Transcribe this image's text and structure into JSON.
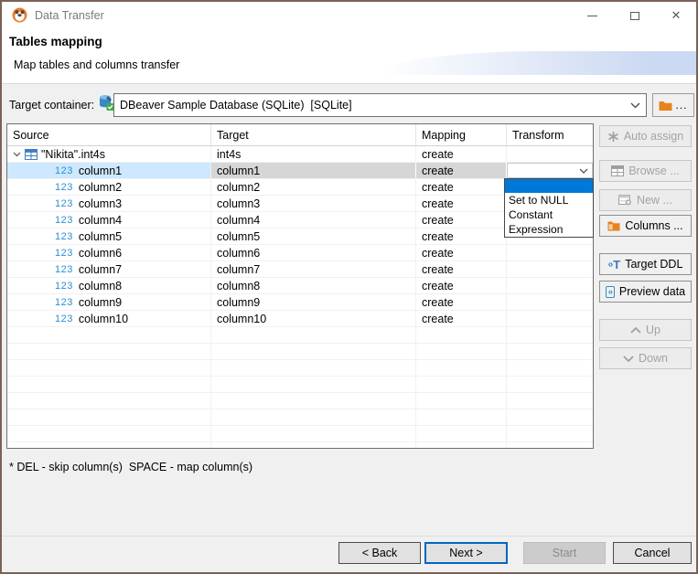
{
  "window": {
    "title": "Data Transfer"
  },
  "header": {
    "title": "Tables mapping",
    "subtitle": "Map tables and columns transfer"
  },
  "target_container": {
    "label": "Target container:",
    "value": "DBeaver Sample Database (SQLite)  [SQLite]",
    "browse_label": "..."
  },
  "table": {
    "columns": [
      "Source",
      "Target",
      "Mapping",
      "Transform"
    ],
    "tree_row": {
      "source": "\"Nikita\".int4s",
      "target": "int4s",
      "mapping": "create"
    },
    "type_badge": "123",
    "rows": [
      {
        "source": "column1",
        "target": "column1",
        "mapping": "create",
        "selected": true
      },
      {
        "source": "column2",
        "target": "column2",
        "mapping": "create",
        "selected": false
      },
      {
        "source": "column3",
        "target": "column3",
        "mapping": "create",
        "selected": false
      },
      {
        "source": "column4",
        "target": "column4",
        "mapping": "create",
        "selected": false
      },
      {
        "source": "column5",
        "target": "column5",
        "mapping": "create",
        "selected": false
      },
      {
        "source": "column6",
        "target": "column6",
        "mapping": "create",
        "selected": false
      },
      {
        "source": "column7",
        "target": "column7",
        "mapping": "create",
        "selected": false
      },
      {
        "source": "column8",
        "target": "column8",
        "mapping": "create",
        "selected": false
      },
      {
        "source": "column9",
        "target": "column9",
        "mapping": "create",
        "selected": false
      },
      {
        "source": "column10",
        "target": "column10",
        "mapping": "create",
        "selected": false
      }
    ]
  },
  "transform_dropdown": {
    "options": [
      "",
      "Set to NULL",
      "Constant",
      "Expression"
    ]
  },
  "side_buttons": [
    {
      "label": "Auto assign",
      "icon": "auto-assign-icon",
      "enabled": false
    },
    {
      "label": "Browse ...",
      "icon": "browse-table-icon",
      "enabled": false
    },
    {
      "label": "New ...",
      "icon": "new-table-icon",
      "enabled": false
    },
    {
      "label": "Columns ...",
      "icon": "columns-icon",
      "enabled": true
    },
    {
      "label": "Target DDL",
      "icon": "target-ddl-icon",
      "enabled": true
    },
    {
      "label": "Preview data",
      "icon": "preview-data-icon",
      "enabled": true
    },
    {
      "label": "Up",
      "icon": "chevron-up-icon",
      "enabled": false
    },
    {
      "label": "Down",
      "icon": "chevron-down-icon",
      "enabled": false
    }
  ],
  "hint": "* DEL - skip column(s)  SPACE - map column(s)",
  "footer": {
    "back": "< Back",
    "next": "Next >",
    "start": "Start",
    "cancel": "Cancel"
  },
  "colors": {
    "accent": "#0078d7",
    "selection_blue": "#cde8ff",
    "selection_grey": "#d6d6d6",
    "window_border": "#7a6156",
    "icon_orange": "#e8821e",
    "icon_blue": "#3a7ab8"
  },
  "side_button_y": [
    135,
    173,
    205,
    233,
    275,
    305,
    347,
    378
  ]
}
